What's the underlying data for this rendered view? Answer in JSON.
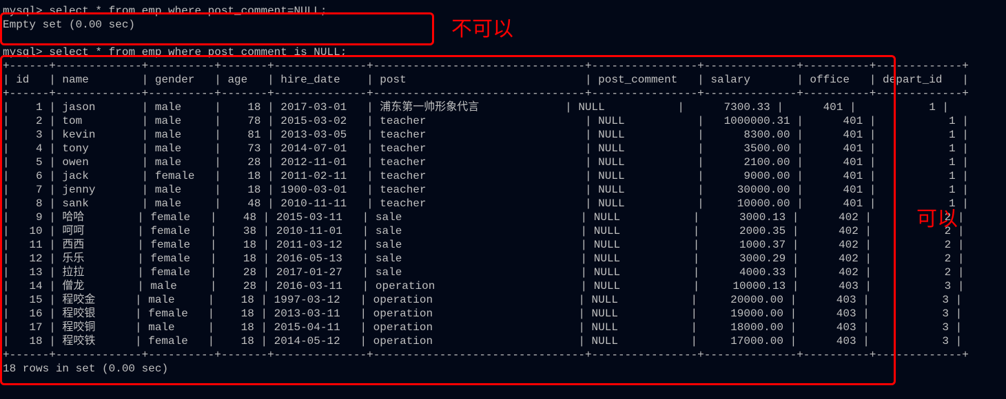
{
  "query1": {
    "prompt": "mysql> ",
    "command": "select * from emp where post_comment=NULL;",
    "result": "Empty set (0.00 sec)"
  },
  "query2": {
    "prompt": "mysql> ",
    "command": "select * from emp where post_comment is NULL;",
    "footer": "18 rows in set (0.00 sec)"
  },
  "columns": [
    "id",
    "name",
    "gender",
    "age",
    "hire_date",
    "post",
    "post_comment",
    "salary",
    "office",
    "depart_id"
  ],
  "rows": [
    {
      "id": "1",
      "name": "jason",
      "gender": "male",
      "age": "18",
      "hire_date": "2017-03-01",
      "post": "浦东第一帅形象代言",
      "post_comment": "NULL",
      "salary": "7300.33",
      "office": "401",
      "depart_id": "1"
    },
    {
      "id": "2",
      "name": "tom",
      "gender": "male",
      "age": "78",
      "hire_date": "2015-03-02",
      "post": "teacher",
      "post_comment": "NULL",
      "salary": "1000000.31",
      "office": "401",
      "depart_id": "1"
    },
    {
      "id": "3",
      "name": "kevin",
      "gender": "male",
      "age": "81",
      "hire_date": "2013-03-05",
      "post": "teacher",
      "post_comment": "NULL",
      "salary": "8300.00",
      "office": "401",
      "depart_id": "1"
    },
    {
      "id": "4",
      "name": "tony",
      "gender": "male",
      "age": "73",
      "hire_date": "2014-07-01",
      "post": "teacher",
      "post_comment": "NULL",
      "salary": "3500.00",
      "office": "401",
      "depart_id": "1"
    },
    {
      "id": "5",
      "name": "owen",
      "gender": "male",
      "age": "28",
      "hire_date": "2012-11-01",
      "post": "teacher",
      "post_comment": "NULL",
      "salary": "2100.00",
      "office": "401",
      "depart_id": "1"
    },
    {
      "id": "6",
      "name": "jack",
      "gender": "female",
      "age": "18",
      "hire_date": "2011-02-11",
      "post": "teacher",
      "post_comment": "NULL",
      "salary": "9000.00",
      "office": "401",
      "depart_id": "1"
    },
    {
      "id": "7",
      "name": "jenny",
      "gender": "male",
      "age": "18",
      "hire_date": "1900-03-01",
      "post": "teacher",
      "post_comment": "NULL",
      "salary": "30000.00",
      "office": "401",
      "depart_id": "1"
    },
    {
      "id": "8",
      "name": "sank",
      "gender": "male",
      "age": "48",
      "hire_date": "2010-11-11",
      "post": "teacher",
      "post_comment": "NULL",
      "salary": "10000.00",
      "office": "401",
      "depart_id": "1"
    },
    {
      "id": "9",
      "name": "哈哈",
      "gender": "female",
      "age": "48",
      "hire_date": "2015-03-11",
      "post": "sale",
      "post_comment": "NULL",
      "salary": "3000.13",
      "office": "402",
      "depart_id": "2"
    },
    {
      "id": "10",
      "name": "呵呵",
      "gender": "female",
      "age": "38",
      "hire_date": "2010-11-01",
      "post": "sale",
      "post_comment": "NULL",
      "salary": "2000.35",
      "office": "402",
      "depart_id": "2"
    },
    {
      "id": "11",
      "name": "西西",
      "gender": "female",
      "age": "18",
      "hire_date": "2011-03-12",
      "post": "sale",
      "post_comment": "NULL",
      "salary": "1000.37",
      "office": "402",
      "depart_id": "2"
    },
    {
      "id": "12",
      "name": "乐乐",
      "gender": "female",
      "age": "18",
      "hire_date": "2016-05-13",
      "post": "sale",
      "post_comment": "NULL",
      "salary": "3000.29",
      "office": "402",
      "depart_id": "2"
    },
    {
      "id": "13",
      "name": "拉拉",
      "gender": "female",
      "age": "28",
      "hire_date": "2017-01-27",
      "post": "sale",
      "post_comment": "NULL",
      "salary": "4000.33",
      "office": "402",
      "depart_id": "2"
    },
    {
      "id": "14",
      "name": "僧龙",
      "gender": "male",
      "age": "28",
      "hire_date": "2016-03-11",
      "post": "operation",
      "post_comment": "NULL",
      "salary": "10000.13",
      "office": "403",
      "depart_id": "3"
    },
    {
      "id": "15",
      "name": "程咬金",
      "gender": "male",
      "age": "18",
      "hire_date": "1997-03-12",
      "post": "operation",
      "post_comment": "NULL",
      "salary": "20000.00",
      "office": "403",
      "depart_id": "3"
    },
    {
      "id": "16",
      "name": "程咬银",
      "gender": "female",
      "age": "18",
      "hire_date": "2013-03-11",
      "post": "operation",
      "post_comment": "NULL",
      "salary": "19000.00",
      "office": "403",
      "depart_id": "3"
    },
    {
      "id": "17",
      "name": "程咬铜",
      "gender": "male",
      "age": "18",
      "hire_date": "2015-04-11",
      "post": "operation",
      "post_comment": "NULL",
      "salary": "18000.00",
      "office": "403",
      "depart_id": "3"
    },
    {
      "id": "18",
      "name": "程咬铁",
      "gender": "female",
      "age": "18",
      "hire_date": "2014-05-12",
      "post": "operation",
      "post_comment": "NULL",
      "salary": "17000.00",
      "office": "403",
      "depart_id": "3"
    }
  ],
  "annotations": {
    "bad": "不可以",
    "good": "可以"
  },
  "col_widths": {
    "id": 4,
    "name": 11,
    "gender": 8,
    "age": 5,
    "hire_date": 12,
    "post": 30,
    "post_comment": 14,
    "salary": 12,
    "office": 8,
    "depart_id": 11
  }
}
